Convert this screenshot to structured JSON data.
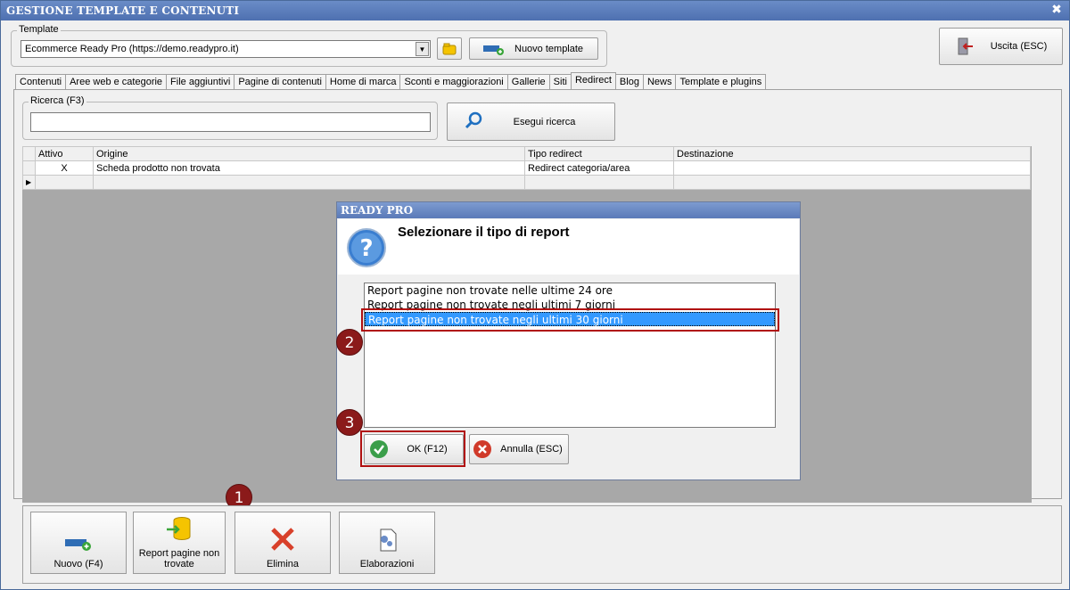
{
  "window": {
    "title": "GESTIONE TEMPLATE E CONTENUTI",
    "close_glyph": "✖"
  },
  "template_group": {
    "legend": "Template",
    "selected": "Ecommerce Ready Pro (https://demo.readypro.it)",
    "new_template_label": "Nuovo template"
  },
  "exit_button": {
    "label": "Uscita (ESC)"
  },
  "tabs": [
    "Contenuti",
    "Aree web e categorie",
    "File aggiuntivi",
    "Pagine di contenuti",
    "Home di marca",
    "Sconti e maggiorazioni",
    "Gallerie",
    "Siti",
    "Redirect",
    "Blog",
    "News",
    "Template e plugins"
  ],
  "active_tab": "Redirect",
  "search": {
    "legend": "Ricerca (F3)",
    "value": "",
    "button_label": "Esegui ricerca"
  },
  "grid": {
    "columns": [
      "Attivo",
      "Origine",
      "Tipo redirect",
      "Destinazione"
    ],
    "rows": [
      {
        "attivo": "X",
        "origine": "Scheda prodotto non trovata",
        "tipo": "Redirect categoria/area",
        "destinazione": ""
      }
    ]
  },
  "dialog": {
    "title": "READY PRO",
    "heading": "Selezionare il tipo di report",
    "options": [
      "Report pagine non trovate nelle ultime 24 ore",
      "Report pagine non trovate negli ultimi 7 giorni",
      "Report pagine non trovate negli ultimi 30 giorni"
    ],
    "selected_index": 2,
    "ok_label": "OK (F12)",
    "cancel_label": "Annulla (ESC)"
  },
  "steps": [
    "1",
    "2",
    "3"
  ],
  "bottom_buttons": {
    "new": "Nuovo (F4)",
    "report": "Report pagine non trovate",
    "delete": "Elimina",
    "process": "Elaborazioni"
  },
  "colors": {
    "accent_red": "#b01010",
    "step_badge": "#8b1a1a",
    "selection": "#3399ff",
    "title_bar": "#5a7ab8"
  }
}
